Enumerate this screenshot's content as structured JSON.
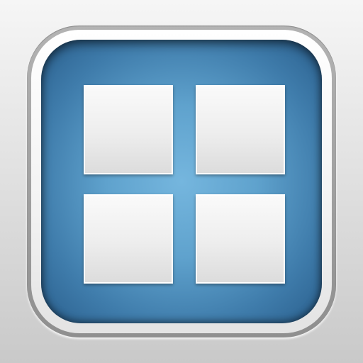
{
  "icon": {
    "depicts": "grid-of-four-tiles-icon",
    "colors": {
      "background": "#e2e2e2",
      "bezel": "#a6a6a6",
      "tray_center": "#75b6de",
      "tray_edge": "#2a5f8d",
      "tile": "#eeeeee",
      "tile_border": "#ffffff"
    },
    "tiles": [
      {
        "position": "top-left"
      },
      {
        "position": "top-right"
      },
      {
        "position": "bottom-left"
      },
      {
        "position": "bottom-right"
      }
    ]
  }
}
